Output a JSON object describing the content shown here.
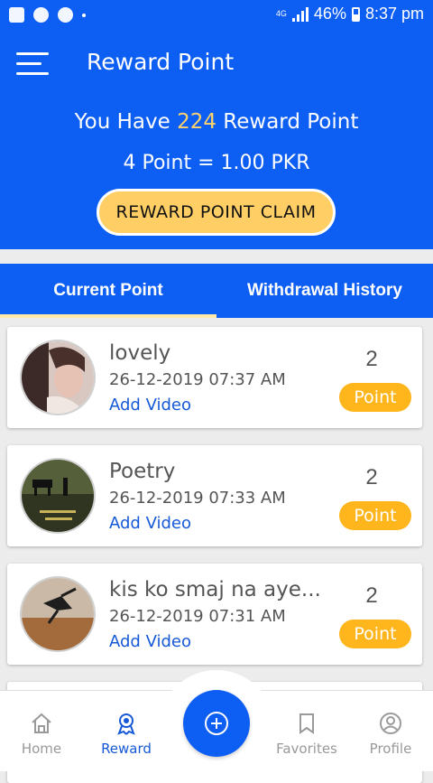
{
  "status_bar": {
    "network": "4G",
    "battery": "46%",
    "time": "8:37 pm"
  },
  "header": {
    "title": "Reward Point",
    "reward_prefix": "You Have",
    "reward_points": "224",
    "reward_suffix": "Reward Point",
    "rate": "4 Point = 1.00 PKR",
    "claim_label": "REWARD POINT CLAIM"
  },
  "tabs": [
    {
      "label": "Current Point",
      "active": true
    },
    {
      "label": "Withdrawal History",
      "active": false
    }
  ],
  "items": [
    {
      "title": "lovely",
      "date": "26-12-2019 07:37 AM",
      "action": "Add Video",
      "points": "2",
      "badge": "Point"
    },
    {
      "title": "Poetry",
      "date": "26-12-2019 07:33 AM",
      "action": "Add Video",
      "points": "2",
      "badge": "Point"
    },
    {
      "title": "kis ko smaj na aye...",
      "date": "26-12-2019 07:31 AM",
      "action": "Add Video",
      "points": "2",
      "badge": "Point"
    }
  ],
  "bottom_nav": {
    "home": "Home",
    "reward": "Reward",
    "favorites": "Favorites",
    "profile": "Profile",
    "add_icon": "plus-circle-icon"
  },
  "colors": {
    "primary": "#0d5ef2",
    "accent": "#ffcf66",
    "badge": "#ffb51c",
    "link": "#1659d6"
  }
}
